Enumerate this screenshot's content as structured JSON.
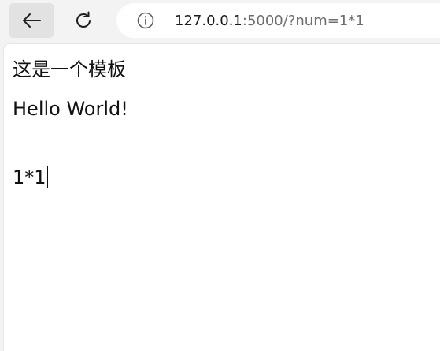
{
  "browser": {
    "url_host": "127.0.0.1",
    "url_rest": ":5000/?num=1*1"
  },
  "page": {
    "title_text": "这是一个模板",
    "hello_text": "Hello World!",
    "result_text": "1*1"
  },
  "icons": {
    "back": "back-arrow-icon",
    "reload": "reload-icon",
    "info": "info-icon"
  }
}
